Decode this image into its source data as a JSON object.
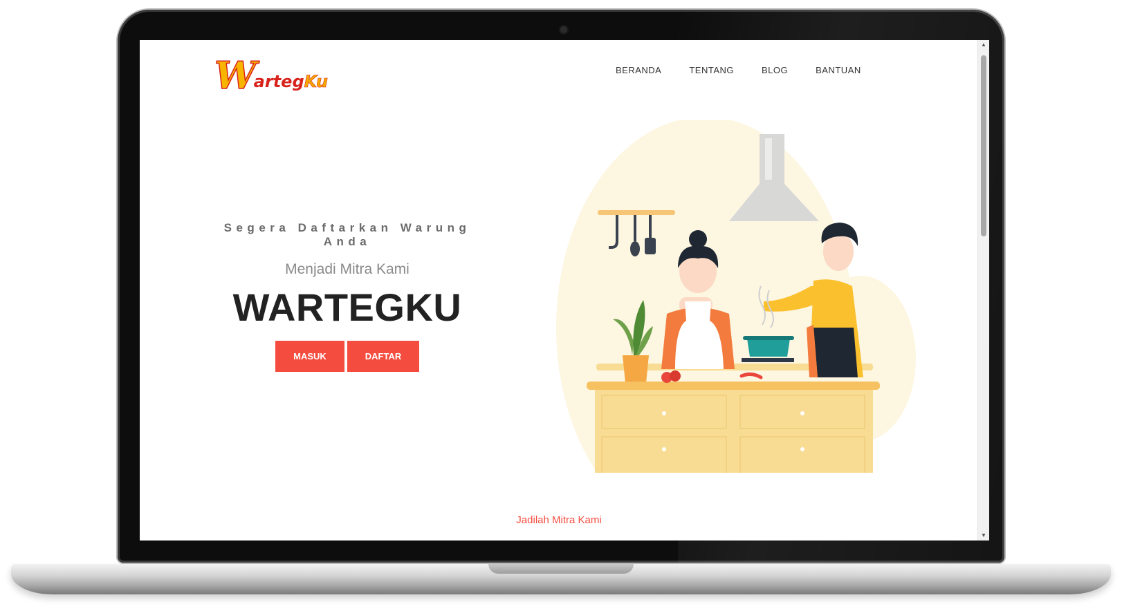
{
  "logo": {
    "w": "W",
    "arteg": "arteg",
    "ku": "Ku"
  },
  "nav": {
    "items": [
      {
        "label": "BERANDA"
      },
      {
        "label": "TENTANG"
      },
      {
        "label": "BLOG"
      },
      {
        "label": "BANTUAN"
      }
    ]
  },
  "hero": {
    "tagline": "Segera Daftarkan Warung Anda",
    "subtitle": "Menjadi Mitra Kami",
    "brand": "WARTEGKU",
    "login_label": "MASUK",
    "register_label": "DAFTAR"
  },
  "next_section": {
    "peek_title": "Jadilah Mitra Kami"
  },
  "colors": {
    "accent": "#f44c3f",
    "logo_yellow": "#f7b500",
    "logo_red": "#d8231c",
    "counter": "#f8dc94"
  },
  "icons": {
    "scroll_up": "triangle-up",
    "scroll_down": "triangle-down"
  }
}
